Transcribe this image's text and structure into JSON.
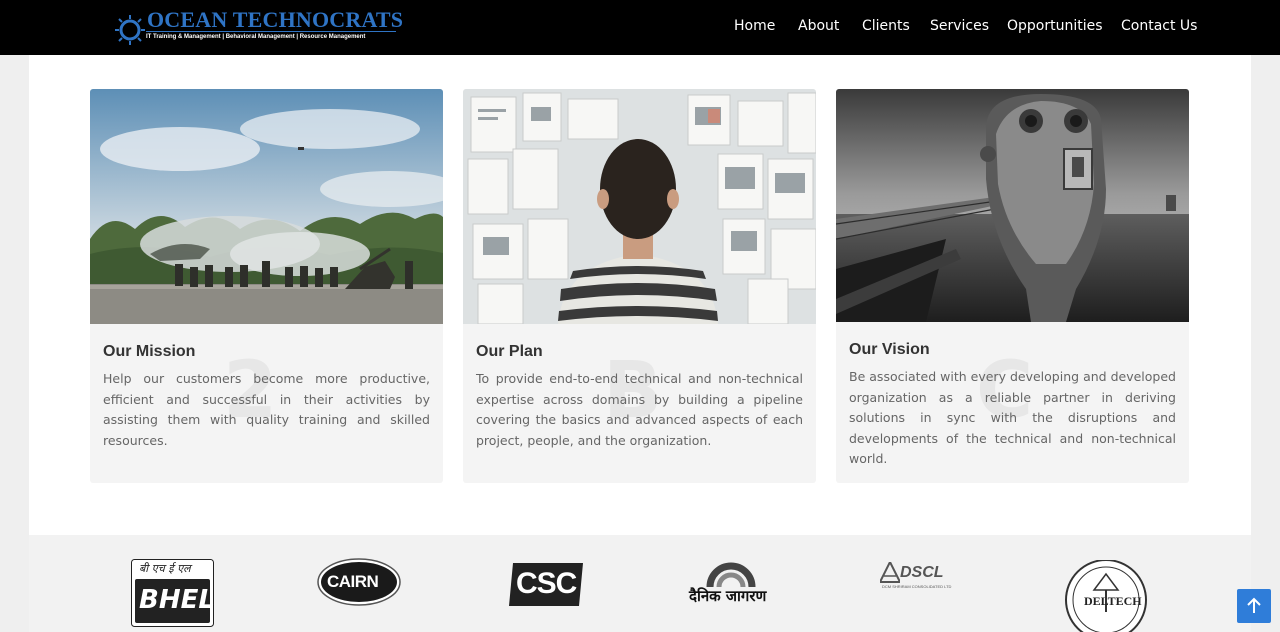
{
  "brand": {
    "name": "OCEAN TECHNOCRATS",
    "tagline": "IT Training & Management | Behavioral Management | Resource Management",
    "logo_icon": "sun-wheel-icon",
    "accent_color": "#2f74c5"
  },
  "nav": {
    "items": [
      {
        "label": "Home"
      },
      {
        "label": "About"
      },
      {
        "label": "Clients"
      },
      {
        "label": "Services"
      },
      {
        "label": "Opportunities"
      },
      {
        "label": "Contact Us"
      }
    ]
  },
  "cards": [
    {
      "title": "Our Mission",
      "text": "Help our customers become more productive, efficient and successful in their activities by assisting them with quality training and skilled resources.",
      "watermark": "2",
      "image": "soldiers-field-photo"
    },
    {
      "title": "Our Plan",
      "text": "To provide end-to-end technical and non-technical expertise across domains by building a pipeline covering the basics and advanced aspects of each project, people, and the organization.",
      "watermark": "B",
      "image": "man-viewing-pinboard-photo"
    },
    {
      "title": "Our Vision",
      "text": "Be associated with every developing and developed organization as a reliable partner in deriving solutions in sync with the disruptions and developments of the technical and non-technical world.",
      "watermark": "C",
      "image": "binocular-viewer-pier-photo"
    }
  ],
  "partners": {
    "bhel": {
      "top": "बी एच ई एल",
      "main": "BHEL"
    },
    "cairn": {
      "main": "CAIRN"
    },
    "csc": {
      "main": "CSC"
    },
    "jagran": {
      "main": "दैनिक जागरण"
    },
    "dscl": {
      "main": "DSCL",
      "sub": "DCM SHRIRAM CONSOLIDATED LTD"
    },
    "deltech": {
      "main": "DELTECH"
    }
  },
  "to_top": {
    "icon": "arrow-up-icon",
    "color": "#2f7dd9"
  }
}
